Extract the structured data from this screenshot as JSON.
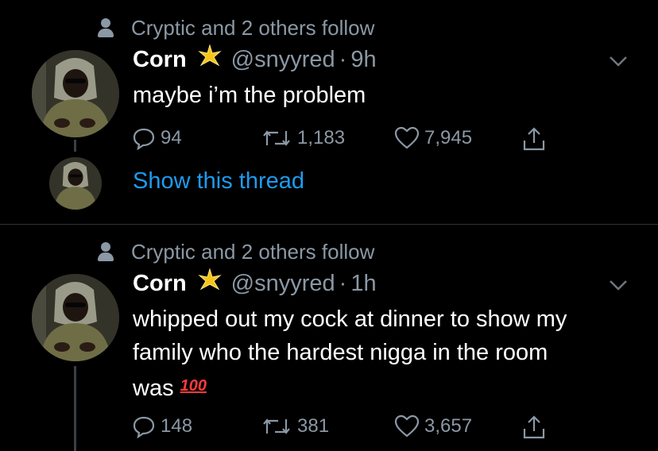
{
  "colors": {
    "background": "#000000",
    "link": "#1d9bf0",
    "muted": "#8b98a5",
    "text": "#ffffff"
  },
  "tweets": [
    {
      "social_context": "Cryptic and 2 others follow",
      "name": "Corn",
      "handle": "@snyyred",
      "time": "9h",
      "text": "maybe i’m the problem",
      "replies": "94",
      "retweets": "1,183",
      "likes": "7,945",
      "show_thread": "Show this thread"
    },
    {
      "social_context": "Cryptic and 2 others follow",
      "name": "Corn",
      "handle": "@snyyred",
      "time": "1h",
      "text_line1": "whipped out my cock at dinner to show my",
      "text_line2": "family who the hardest nigga in the room",
      "text_line3": "was",
      "emoji": "100",
      "replies": "148",
      "retweets": "381",
      "likes": "3,657"
    }
  ],
  "separator": "·",
  "icons": [
    "person-icon",
    "verified-star-icon",
    "chevron-down-icon",
    "reply-icon",
    "retweet-icon",
    "like-icon",
    "share-icon",
    "hundred-points-emoji"
  ]
}
